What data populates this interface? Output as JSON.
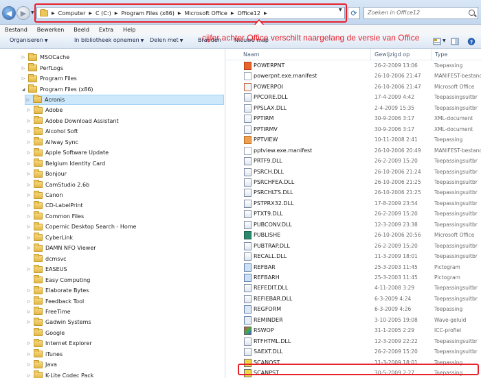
{
  "address": {
    "breadcrumbs": [
      "Computer",
      "C (C:)",
      "Program Files (x86)",
      "Microsoft Office",
      "Office12"
    ],
    "search_placeholder": "Zoeken in Office12"
  },
  "menu": [
    "Bestand",
    "Bewerken",
    "Beeld",
    "Extra",
    "Help"
  ],
  "commands": {
    "organize": "Organiseren",
    "include": "In bibliotheek opnemen",
    "share": "Delen met",
    "burn": "Branden",
    "new_folder": "Nieuwe map"
  },
  "annotation": "cijfer achter Office verschilt naargelang de versie van Office",
  "columns": {
    "name": "Naam",
    "date": "Gewijzigd op",
    "type": "Type"
  },
  "tree": [
    {
      "label": "MSOCache",
      "level": 1,
      "expander": "▷"
    },
    {
      "label": "PerfLogs",
      "level": 1,
      "expander": "▷"
    },
    {
      "label": "Program Files",
      "level": 1,
      "expander": "▷"
    },
    {
      "label": "Program Files (x86)",
      "level": 1,
      "expander": "◢"
    },
    {
      "label": "Acronis",
      "level": 2,
      "expander": "▷",
      "selected": true
    },
    {
      "label": "Adobe",
      "level": 2,
      "expander": "▷"
    },
    {
      "label": "Adobe Download Assistant",
      "level": 2,
      "expander": "▷"
    },
    {
      "label": "Alcohol Soft",
      "level": 2,
      "expander": "▷"
    },
    {
      "label": "Allway Sync",
      "level": 2,
      "expander": "▷"
    },
    {
      "label": "Apple Software Update",
      "level": 2,
      "expander": "▷"
    },
    {
      "label": "Belgium Identity Card",
      "level": 2,
      "expander": "▷"
    },
    {
      "label": "Bonjour",
      "level": 2,
      "expander": "▷"
    },
    {
      "label": "CamStudio 2.6b",
      "level": 2,
      "expander": "▷"
    },
    {
      "label": "Canon",
      "level": 2,
      "expander": "▷"
    },
    {
      "label": "CD-LabelPrint",
      "level": 2,
      "expander": "▷"
    },
    {
      "label": "Common Files",
      "level": 2,
      "expander": "▷"
    },
    {
      "label": "Copernic Desktop Search - Home",
      "level": 2,
      "expander": "▷"
    },
    {
      "label": "CyberLink",
      "level": 2,
      "expander": "▷"
    },
    {
      "label": "DAMN NFO Viewer",
      "level": 2,
      "expander": "▷"
    },
    {
      "label": "dcmsvc",
      "level": 2,
      "expander": ""
    },
    {
      "label": "EASEUS",
      "level": 2,
      "expander": "▷"
    },
    {
      "label": "Easy Computing",
      "level": 2,
      "expander": ""
    },
    {
      "label": "Elaborate Bytes",
      "level": 2,
      "expander": "▷"
    },
    {
      "label": "Feedback Tool",
      "level": 2,
      "expander": "▷"
    },
    {
      "label": "FreeTime",
      "level": 2,
      "expander": "▷"
    },
    {
      "label": "Gadwin Systems",
      "level": 2,
      "expander": "▷"
    },
    {
      "label": "Google",
      "level": 2,
      "expander": ""
    },
    {
      "label": "Internet Explorer",
      "level": 2,
      "expander": "▷"
    },
    {
      "label": "iTunes",
      "level": 2,
      "expander": "▷"
    },
    {
      "label": "Java",
      "level": 2,
      "expander": "▷"
    },
    {
      "label": "K-Lite Codec Pack",
      "level": 2,
      "expander": "▷"
    }
  ],
  "files": [
    {
      "name": "POWERPNT",
      "date": "26-2-2009 13:06",
      "type": "Toepassing",
      "icon": "powerpoint-app-icon"
    },
    {
      "name": "powerpnt.exe.manifest",
      "date": "26-10-2006 21:47",
      "type": "MANIFEST-bestand",
      "icon": "file-icon"
    },
    {
      "name": "POWERPOI",
      "date": "26-10-2006 21:47",
      "type": "Microsoft Office",
      "icon": "office-doc-icon"
    },
    {
      "name": "PPCORE.DLL",
      "date": "17-4-2009 4:42",
      "type": "Toepassingsuitbr",
      "icon": "dll-icon"
    },
    {
      "name": "PPSLAX.DLL",
      "date": "2-4-2009 15:35",
      "type": "Toepassingsuitbr",
      "icon": "dll-icon"
    },
    {
      "name": "PPTIRM",
      "date": "30-9-2006 3:17",
      "type": "XML-document",
      "icon": "xml-icon"
    },
    {
      "name": "PPTIRMV",
      "date": "30-9-2006 3:17",
      "type": "XML-document",
      "icon": "xml-icon"
    },
    {
      "name": "PPTVIEW",
      "date": "10-11-2008 2:41",
      "type": "Toepassing",
      "icon": "pptview-icon"
    },
    {
      "name": "pptview.exe.manifest",
      "date": "26-10-2006 20:49",
      "type": "MANIFEST-bestand",
      "icon": "file-icon"
    },
    {
      "name": "PRTF9.DLL",
      "date": "26-2-2009 15:20",
      "type": "Toepassingsuitbr",
      "icon": "dll-icon"
    },
    {
      "name": "PSRCH.DLL",
      "date": "26-10-2006 21:24",
      "type": "Toepassingsuitbr",
      "icon": "dll-icon"
    },
    {
      "name": "PSRCHFEA.DLL",
      "date": "26-10-2006 21:25",
      "type": "Toepassingsuitbr",
      "icon": "dll-icon"
    },
    {
      "name": "PSRCHLTS.DLL",
      "date": "26-10-2006 21:25",
      "type": "Toepassingsuitbr",
      "icon": "dll-icon"
    },
    {
      "name": "PSTPRX32.DLL",
      "date": "17-8-2009 23:54",
      "type": "Toepassingsuitbr",
      "icon": "dll-icon"
    },
    {
      "name": "PTXT9.DLL",
      "date": "26-2-2009 15:20",
      "type": "Toepassingsuitbr",
      "icon": "dll-icon"
    },
    {
      "name": "PUBCONV.DLL",
      "date": "12-3-2009 23:38",
      "type": "Toepassingsuitbr",
      "icon": "dll-icon"
    },
    {
      "name": "PUBLISHE",
      "date": "26-10-2006 20:56",
      "type": "Microsoft Office",
      "icon": "publisher-icon"
    },
    {
      "name": "PUBTRAP.DLL",
      "date": "26-2-2009 15:20",
      "type": "Toepassingsuitbr",
      "icon": "dll-icon"
    },
    {
      "name": "RECALL.DLL",
      "date": "11-3-2009 18:01",
      "type": "Toepassingsuitbr",
      "icon": "dll-icon"
    },
    {
      "name": "REFBAR",
      "date": "25-3-2003 11:45",
      "type": "Pictogram",
      "icon": "picture-icon"
    },
    {
      "name": "REFBARH",
      "date": "25-3-2003 11:45",
      "type": "Pictogram",
      "icon": "picture-icon"
    },
    {
      "name": "REFEDIT.DLL",
      "date": "4-11-2008 3:29",
      "type": "Toepassingsuitbr",
      "icon": "dll-icon"
    },
    {
      "name": "REFIEBAR.DLL",
      "date": "6-3-2009 4:24",
      "type": "Toepassingsuitbr",
      "icon": "dll-icon"
    },
    {
      "name": "REGFORM",
      "date": "6-3-2009 4:26",
      "type": "Toepassing",
      "icon": "app-icon"
    },
    {
      "name": "REMINDER",
      "date": "3-10-2005 19:08",
      "type": "Wave-geluid",
      "icon": "audio-icon"
    },
    {
      "name": "RSWOP",
      "date": "31-1-2005 2:29",
      "type": "ICC-profiel",
      "icon": "color-profile-icon"
    },
    {
      "name": "RTFHTML.DLL",
      "date": "12-3-2009 22:22",
      "type": "Toepassingsuitbr",
      "icon": "dll-icon"
    },
    {
      "name": "SAEXT.DLL",
      "date": "26-2-2009 15:20",
      "type": "Toepassingsuitbr",
      "icon": "dll-icon"
    },
    {
      "name": "SCANOST",
      "date": "11-3-2009 18:01",
      "type": "Toepassing",
      "icon": "scan-app-icon"
    },
    {
      "name": "SCANPST",
      "date": "30-5-2009 2:27",
      "type": "Toepassing",
      "icon": "scan-app-icon"
    }
  ],
  "colors": {
    "highlight": "#e8202a",
    "selection": "#cde8fb",
    "accent": "#2a62b0"
  }
}
